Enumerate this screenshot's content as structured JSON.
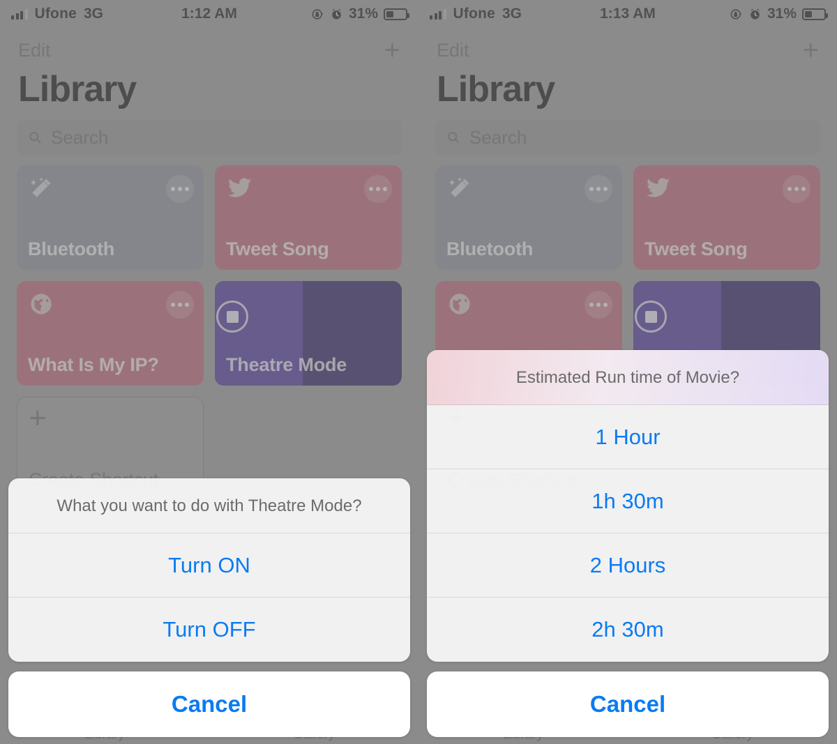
{
  "panels": [
    {
      "id": "left",
      "status": {
        "carrier": "Ufone",
        "network": "3G",
        "time": "1:12 AM",
        "battery_percent": "31%",
        "rotation_lock_icon": "rotation-lock-icon",
        "alarm_icon": "alarm-icon",
        "signal_icon": "signal-bars-icon",
        "battery_icon": "battery-icon"
      },
      "nav": {
        "edit_label": "Edit",
        "add_icon": "plus-icon"
      },
      "page_title": "Library",
      "search": {
        "placeholder": "Search",
        "icon": "search-icon"
      },
      "cards": [
        {
          "name": "Bluetooth",
          "color": "#8b8f99",
          "style": "gray",
          "icon": "magic-wand-icon",
          "menu_icon": "more-dots-icon"
        },
        {
          "name": "Tweet Song",
          "color": "#bd6376",
          "style": "red",
          "icon": "twitter-bird-icon",
          "menu_icon": "more-dots-icon"
        },
        {
          "name": "What Is My IP?",
          "color": "#bd6376",
          "style": "red",
          "icon": "globe-icon",
          "menu_icon": "more-dots-icon"
        },
        {
          "name": "Theatre Mode",
          "color": "#2a1960",
          "style": "purple",
          "icon": "",
          "running": true,
          "progress_percent": 47,
          "stop_icon": "stop-button-icon"
        },
        {
          "name": "Create Shortcut",
          "style": "create",
          "icon": "plus-icon"
        }
      ],
      "tabs": [
        {
          "label": "Library"
        },
        {
          "label": "Gallery"
        }
      ],
      "sheet": {
        "title": "What you want to do with Theatre Mode?",
        "tinted": false,
        "options": [
          {
            "label": "Turn ON"
          },
          {
            "label": "Turn OFF"
          }
        ],
        "cancel_label": "Cancel"
      }
    },
    {
      "id": "right",
      "status": {
        "carrier": "Ufone",
        "network": "3G",
        "time": "1:13 AM",
        "battery_percent": "31%",
        "rotation_lock_icon": "rotation-lock-icon",
        "alarm_icon": "alarm-icon",
        "signal_icon": "signal-bars-icon",
        "battery_icon": "battery-icon"
      },
      "nav": {
        "edit_label": "Edit",
        "add_icon": "plus-icon"
      },
      "page_title": "Library",
      "search": {
        "placeholder": "Search",
        "icon": "search-icon"
      },
      "cards": [
        {
          "name": "Bluetooth",
          "color": "#8b8f99",
          "style": "gray",
          "icon": "magic-wand-icon",
          "menu_icon": "more-dots-icon"
        },
        {
          "name": "Tweet Song",
          "color": "#bd6376",
          "style": "red",
          "icon": "twitter-bird-icon",
          "menu_icon": "more-dots-icon"
        },
        {
          "name": "What Is My IP?",
          "color": "#bd6376",
          "style": "red",
          "icon": "globe-icon",
          "menu_icon": "more-dots-icon"
        },
        {
          "name": "Theatre Mode",
          "color": "#2a1960",
          "style": "purple",
          "icon": "",
          "running": true,
          "progress_percent": 47,
          "stop_icon": "stop-button-icon"
        },
        {
          "name": "Create Shortcut",
          "style": "create",
          "icon": "plus-icon"
        }
      ],
      "tabs": [
        {
          "label": "Library"
        },
        {
          "label": "Gallery"
        }
      ],
      "sheet": {
        "title": "Estimated Run time of Movie?",
        "tinted": true,
        "options": [
          {
            "label": "1 Hour"
          },
          {
            "label": "1h 30m"
          },
          {
            "label": "2 Hours"
          },
          {
            "label": "2h 30m"
          }
        ],
        "cancel_label": "Cancel"
      }
    }
  ],
  "colors": {
    "accent_blue": "#0a7bf2",
    "background_gray": "#9a9a9a",
    "card_gray": "#8b8f99",
    "card_red": "#bd6376",
    "card_purple_dark": "#2a1960",
    "card_purple_light": "#4a329c",
    "sheet_white": "#f9f9f9"
  }
}
